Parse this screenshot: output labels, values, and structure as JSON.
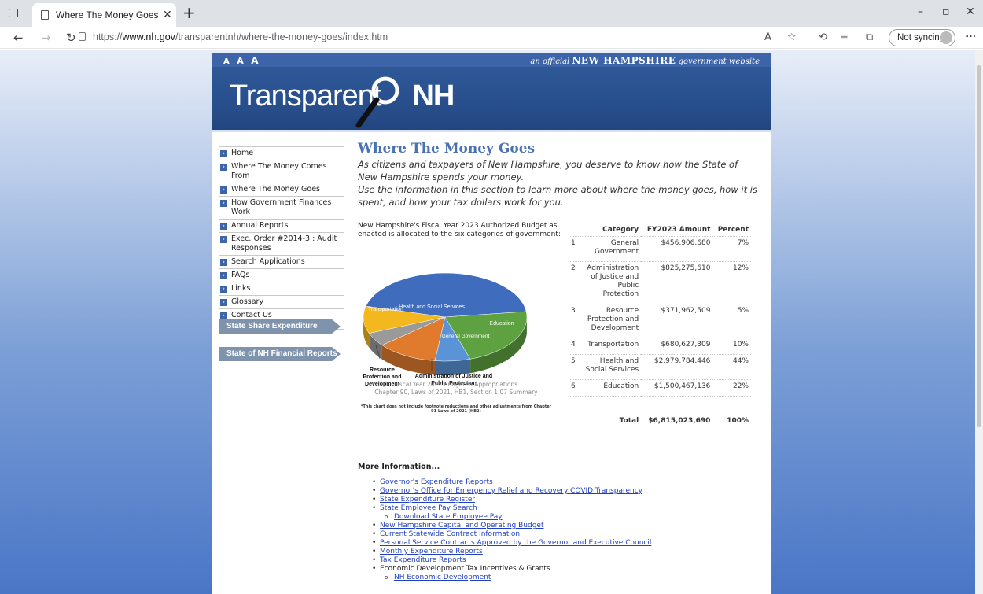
{
  "browser": {
    "tab_title": "Where The Money Goes | Transp",
    "url_prefix": "https://",
    "url_host": "www.nh.gov",
    "url_path": "/transparentnh/where-the-money-goes/index.htm",
    "profile_label": "Not syncing"
  },
  "site": {
    "text_size": [
      "A",
      "A",
      "A"
    ],
    "official_pre": "an official",
    "official_state": "NEW HAMPSHIRE",
    "official_post": "government website",
    "logo_text": "Transparent",
    "logo_suffix": "NH"
  },
  "sidebar": {
    "items": [
      {
        "label": "Home"
      },
      {
        "label": "Where The Money Comes From"
      },
      {
        "label": "Where The Money Goes"
      },
      {
        "label": "How Government Finances Work"
      },
      {
        "label": "Annual Reports"
      },
      {
        "label": "Exec. Order #2014-3 : Audit Responses"
      },
      {
        "label": "Search Applications"
      },
      {
        "label": "FAQs"
      },
      {
        "label": "Links"
      },
      {
        "label": "Glossary"
      },
      {
        "label": "Contact Us"
      }
    ],
    "buttons": [
      {
        "label": "State Share Expenditure Reports"
      },
      {
        "label": "State of NH Financial Reports"
      }
    ]
  },
  "main": {
    "title": "Where The Money Goes",
    "intro1": "As citizens and taxpayers of New Hampshire, you deserve to know how the State of New Hampshire spends your money.",
    "intro2": "Use the information in this section to learn more about where the money goes, how it is spent, and how your tax dollars work for you.",
    "pie_lead": "New Hampshire's Fiscal Year 2023 Authorized Budget as enacted is allocated to the six categories of government:",
    "pie_caption_1": "Fiscal Year 2022 Budgeted Appropriations",
    "pie_caption_2": "Chapter 90, Laws of 2021, HB1, Section 1.07 Summary",
    "pie_note": "*This chart does not include footnote reductions and other adjustments from Chapter 91 Laws of 2021 (HB2)",
    "pie_labels": {
      "health": "Health and Social Services",
      "transportation": "Transportation",
      "education": "Education",
      "general": "General Government",
      "resource": "Resource Protection and Development",
      "justice": "Administration of Justice and Public Protection"
    },
    "table": {
      "headers": {
        "category": "Category",
        "amount": "FY2023 Amount",
        "percent": "Percent"
      },
      "rows": [
        {
          "num": "1",
          "category": "General Government",
          "amount": "$456,906,680",
          "percent": "7%"
        },
        {
          "num": "2",
          "category": "Administration of Justice and Public Protection",
          "amount": "$825,275,610",
          "percent": "12%"
        },
        {
          "num": "3",
          "category": "Resource Protection and Development",
          "amount": "$371,962,509",
          "percent": "5%"
        },
        {
          "num": "4",
          "category": "Transportation",
          "amount": "$680,627,309",
          "percent": "10%"
        },
        {
          "num": "5",
          "category": "Health and Social Services",
          "amount": "$2,979,784,446",
          "percent": "44%"
        },
        {
          "num": "6",
          "category": "Education",
          "amount": "$1,500,467,136",
          "percent": "22%"
        }
      ],
      "total_label": "Total",
      "total_amount": "$6,815,023,690",
      "total_percent": "100%"
    }
  },
  "more_info": {
    "heading": "More Information...",
    "links": [
      {
        "label": "Governor's Expenditure Reports",
        "sub": false,
        "link": true
      },
      {
        "label": "Governor's Office for Emergency Relief and Recovery COVID Transparency",
        "sub": false,
        "link": true
      },
      {
        "label": "State Expenditure Register",
        "sub": false,
        "link": true
      },
      {
        "label": "State Employee Pay Search",
        "sub": false,
        "link": true
      },
      {
        "label": "Download State Employee Pay",
        "sub": true,
        "link": true
      },
      {
        "label": "New Hampshire Capital and Operating Budget",
        "sub": false,
        "link": true
      },
      {
        "label": "Current Statewide Contract Information",
        "sub": false,
        "link": true
      },
      {
        "label": "Personal Service Contracts Approved by the Governor and Executive Council",
        "sub": false,
        "link": true
      },
      {
        "label": "Monthly Expenditure Reports",
        "sub": false,
        "link": true
      },
      {
        "label": "Tax Expenditure Reports",
        "sub": false,
        "link": true
      },
      {
        "label": "Economic Development Tax Incentives & Grants",
        "sub": false,
        "link": false
      },
      {
        "label": "NH Economic Development",
        "sub": true,
        "link": true
      }
    ]
  },
  "chart_data": {
    "type": "pie",
    "title": "",
    "categories": [
      "General Government",
      "Administration of Justice and Public Protection",
      "Resource Protection and Development",
      "Transportation",
      "Health and Social Services",
      "Education"
    ],
    "values": [
      7,
      12,
      5,
      10,
      44,
      22
    ],
    "colors": [
      "#5a93d6",
      "#e07b2e",
      "#9a9a9a",
      "#f2b81e",
      "#3f6cbd",
      "#5da140"
    ]
  }
}
